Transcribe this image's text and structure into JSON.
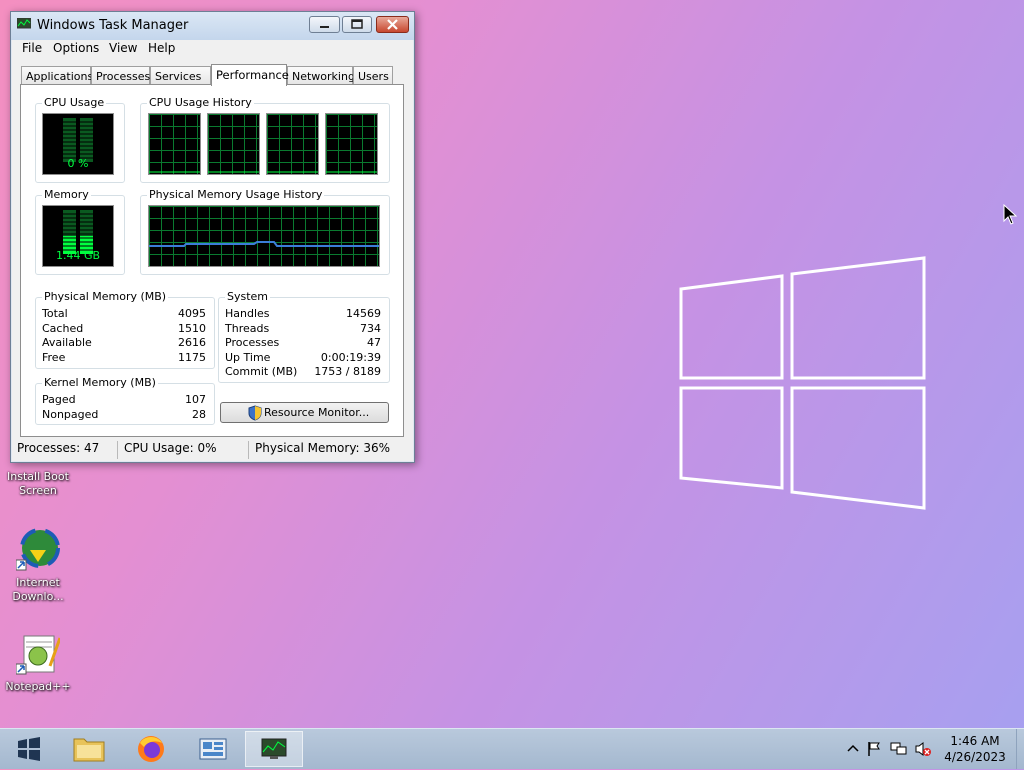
{
  "window": {
    "title": "Windows Task Manager",
    "menu": [
      "File",
      "Options",
      "View",
      "Help"
    ],
    "tabs": [
      "Applications",
      "Processes",
      "Services",
      "Performance",
      "Networking",
      "Users"
    ],
    "active_tab": "Performance"
  },
  "performance": {
    "cpu_usage_label": "CPU Usage",
    "cpu_usage_value": "0 %",
    "cpu_history_label": "CPU Usage History",
    "memory_label": "Memory",
    "memory_value": "1.44 GB",
    "phys_history_label": "Physical Memory Usage History"
  },
  "physical_memory": {
    "label": "Physical Memory (MB)",
    "rows": [
      {
        "name": "Total",
        "value": "4095"
      },
      {
        "name": "Cached",
        "value": "1510"
      },
      {
        "name": "Available",
        "value": "2616"
      },
      {
        "name": "Free",
        "value": "1175"
      }
    ]
  },
  "kernel_memory": {
    "label": "Kernel Memory (MB)",
    "rows": [
      {
        "name": "Paged",
        "value": "107"
      },
      {
        "name": "Nonpaged",
        "value": "28"
      }
    ]
  },
  "system": {
    "label": "System",
    "rows": [
      {
        "name": "Handles",
        "value": "14569"
      },
      {
        "name": "Threads",
        "value": "734"
      },
      {
        "name": "Processes",
        "value": "47"
      },
      {
        "name": "Up Time",
        "value": "0:00:19:39"
      },
      {
        "name": "Commit (MB)",
        "value": "1753 / 8189"
      }
    ]
  },
  "resource_monitor_button": "Resource Monitor...",
  "status_bar": {
    "processes": "Processes: 47",
    "cpu": "CPU Usage: 0%",
    "memory": "Physical Memory: 36%"
  },
  "desktop_icons": [
    {
      "label": "Install Boot Screen",
      "icon": "install-boot-icon"
    },
    {
      "label": "Internet Downlo...",
      "icon": "internet-download-manager-icon"
    },
    {
      "label": "Notepad++",
      "icon": "notepad-plus-plus-icon"
    }
  ],
  "taskbar": {
    "time": "1:46 AM",
    "date": "4/26/2023"
  },
  "colors": {
    "graph_green": "#00ff40",
    "graph_grid": "#0a7a2f",
    "memory_line": "#3b7dd8"
  }
}
